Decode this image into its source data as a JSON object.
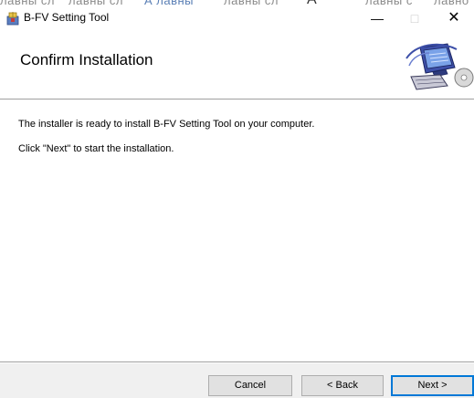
{
  "background_strip": [
    "лавны сл",
    "лавны сл",
    "А лавны",
    "лавны сл",
    "А",
    "лавны с",
    "лавно"
  ],
  "window": {
    "title": "B-FV Setting Tool",
    "minimize_glyph": "—",
    "maximize_glyph": "□",
    "close_glyph": "✕"
  },
  "banner": {
    "title": "Confirm Installation",
    "graphic_icon": "computer-setup-icon"
  },
  "content": {
    "line1": "The installer is ready to install B-FV Setting Tool on your computer.",
    "line2": "Click \"Next\" to start the installation."
  },
  "buttons": {
    "cancel": "Cancel",
    "back": "< Back",
    "next": "Next >"
  },
  "colors": {
    "footer_bg": "#f0f0f0",
    "accent": "#0078d7"
  }
}
